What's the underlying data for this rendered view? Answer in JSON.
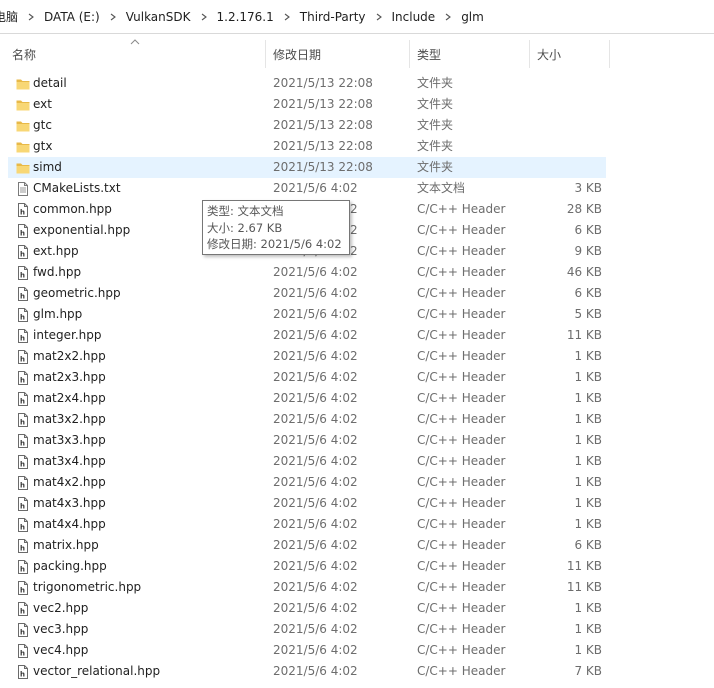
{
  "breadcrumb": [
    "电脑",
    "DATA (E:)",
    "VulkanSDK",
    "1.2.176.1",
    "Third-Party",
    "Include",
    "glm"
  ],
  "columns": {
    "name": "名称",
    "date": "修改日期",
    "type": "类型",
    "size": "大小"
  },
  "rows": [
    {
      "name": "detail",
      "date": "2021/5/13 22:08",
      "type": "文件夹",
      "size": "",
      "kind": "folder"
    },
    {
      "name": "ext",
      "date": "2021/5/13 22:08",
      "type": "文件夹",
      "size": "",
      "kind": "folder"
    },
    {
      "name": "gtc",
      "date": "2021/5/13 22:08",
      "type": "文件夹",
      "size": "",
      "kind": "folder"
    },
    {
      "name": "gtx",
      "date": "2021/5/13 22:08",
      "type": "文件夹",
      "size": "",
      "kind": "folder"
    },
    {
      "name": "simd",
      "date": "2021/5/13 22:08",
      "type": "文件夹",
      "size": "",
      "kind": "folder",
      "selected": true
    },
    {
      "name": "CMakeLists.txt",
      "date": "2021/5/6 4:02",
      "type": "文本文档",
      "size": "3 KB",
      "kind": "text"
    },
    {
      "name": "common.hpp",
      "date": "2021/5/6 4:02",
      "type": "C/C++ Header",
      "size": "28 KB",
      "kind": "header"
    },
    {
      "name": "exponential.hpp",
      "date": "2021/5/6 4:02",
      "type": "C/C++ Header",
      "size": "6 KB",
      "kind": "header"
    },
    {
      "name": "ext.hpp",
      "date": "2021/5/6 4:02",
      "type": "C/C++ Header",
      "size": "9 KB",
      "kind": "header"
    },
    {
      "name": "fwd.hpp",
      "date": "2021/5/6 4:02",
      "type": "C/C++ Header",
      "size": "46 KB",
      "kind": "header"
    },
    {
      "name": "geometric.hpp",
      "date": "2021/5/6 4:02",
      "type": "C/C++ Header",
      "size": "6 KB",
      "kind": "header"
    },
    {
      "name": "glm.hpp",
      "date": "2021/5/6 4:02",
      "type": "C/C++ Header",
      "size": "5 KB",
      "kind": "header"
    },
    {
      "name": "integer.hpp",
      "date": "2021/5/6 4:02",
      "type": "C/C++ Header",
      "size": "11 KB",
      "kind": "header"
    },
    {
      "name": "mat2x2.hpp",
      "date": "2021/5/6 4:02",
      "type": "C/C++ Header",
      "size": "1 KB",
      "kind": "header"
    },
    {
      "name": "mat2x3.hpp",
      "date": "2021/5/6 4:02",
      "type": "C/C++ Header",
      "size": "1 KB",
      "kind": "header"
    },
    {
      "name": "mat2x4.hpp",
      "date": "2021/5/6 4:02",
      "type": "C/C++ Header",
      "size": "1 KB",
      "kind": "header"
    },
    {
      "name": "mat3x2.hpp",
      "date": "2021/5/6 4:02",
      "type": "C/C++ Header",
      "size": "1 KB",
      "kind": "header"
    },
    {
      "name": "mat3x3.hpp",
      "date": "2021/5/6 4:02",
      "type": "C/C++ Header",
      "size": "1 KB",
      "kind": "header"
    },
    {
      "name": "mat3x4.hpp",
      "date": "2021/5/6 4:02",
      "type": "C/C++ Header",
      "size": "1 KB",
      "kind": "header"
    },
    {
      "name": "mat4x2.hpp",
      "date": "2021/5/6 4:02",
      "type": "C/C++ Header",
      "size": "1 KB",
      "kind": "header"
    },
    {
      "name": "mat4x3.hpp",
      "date": "2021/5/6 4:02",
      "type": "C/C++ Header",
      "size": "1 KB",
      "kind": "header"
    },
    {
      "name": "mat4x4.hpp",
      "date": "2021/5/6 4:02",
      "type": "C/C++ Header",
      "size": "1 KB",
      "kind": "header"
    },
    {
      "name": "matrix.hpp",
      "date": "2021/5/6 4:02",
      "type": "C/C++ Header",
      "size": "6 KB",
      "kind": "header"
    },
    {
      "name": "packing.hpp",
      "date": "2021/5/6 4:02",
      "type": "C/C++ Header",
      "size": "11 KB",
      "kind": "header"
    },
    {
      "name": "trigonometric.hpp",
      "date": "2021/5/6 4:02",
      "type": "C/C++ Header",
      "size": "11 KB",
      "kind": "header"
    },
    {
      "name": "vec2.hpp",
      "date": "2021/5/6 4:02",
      "type": "C/C++ Header",
      "size": "1 KB",
      "kind": "header"
    },
    {
      "name": "vec3.hpp",
      "date": "2021/5/6 4:02",
      "type": "C/C++ Header",
      "size": "1 KB",
      "kind": "header"
    },
    {
      "name": "vec4.hpp",
      "date": "2021/5/6 4:02",
      "type": "C/C++ Header",
      "size": "1 KB",
      "kind": "header"
    },
    {
      "name": "vector_relational.hpp",
      "date": "2021/5/6 4:02",
      "type": "C/C++ Header",
      "size": "7 KB",
      "kind": "header"
    }
  ],
  "tooltip": {
    "type_line": "类型: 文本文档",
    "size_line": "大小: 2.67 KB",
    "date_line": "修改日期: 2021/5/6 4:02"
  },
  "icons": {
    "folder": "folder-icon",
    "text": "text-file-icon",
    "header": "header-file-icon",
    "separator": "chevron-right-icon",
    "sort": "sort-ascending-icon"
  },
  "colors": {
    "selected_row": "#e5f3ff",
    "folder": "#f8d775",
    "secondary_text": "#6d6d6d"
  }
}
